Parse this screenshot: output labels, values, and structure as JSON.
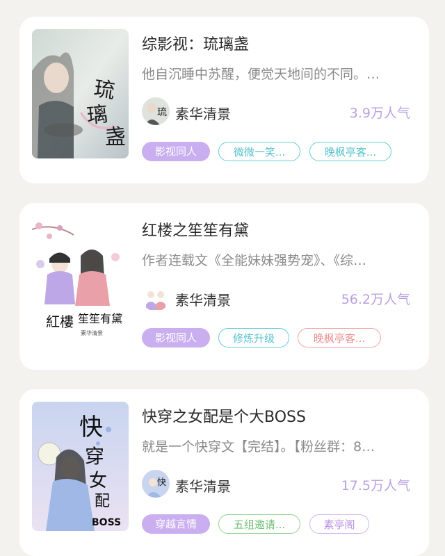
{
  "books": [
    {
      "title": "综影视：琉璃盏",
      "description": "他自沉睡中苏醒，便觉天地间的不同。…",
      "author": "素华清景",
      "popularity": "3.9万人气",
      "tags": [
        "影视同人",
        "微微一笑...",
        "晚枫亭客..."
      ],
      "cover_text": "琉璃盏"
    },
    {
      "title": "红楼之笙笙有黛",
      "description": "作者连载文《全能妹妹强势宠》、《综…",
      "author": "素华清景",
      "popularity": "56.2万人气",
      "tags": [
        "影视同人",
        "修炼升级",
        "晚枫亭客..."
      ],
      "cover_text": "红楼之笙笙有黛"
    },
    {
      "title": "快穿之女配是个大BOSS",
      "description": "就是一个快穿文【完结】。【粉丝群：8…",
      "author": "素华清景",
      "popularity": "17.5万人气",
      "tags": [
        "穿越言情",
        "五组邀请...",
        "素亭阁"
      ],
      "cover_text": "快穿女配BOSS"
    }
  ],
  "colors": {
    "accent": "#c9aef0",
    "popularity": "#b9a0e0",
    "teal": "#62cdd6",
    "red": "#f0a3a3",
    "green": "#8fd193"
  }
}
